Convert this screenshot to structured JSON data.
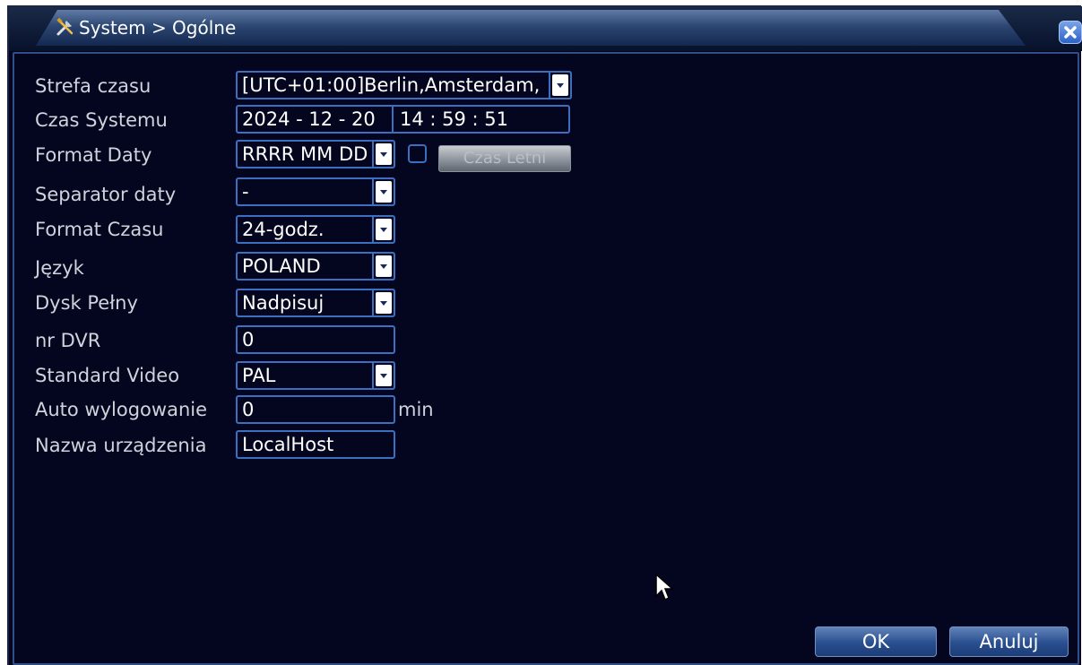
{
  "window": {
    "title": "System > Ogólne"
  },
  "form": {
    "timezone": {
      "label": "Strefa czasu",
      "value": "[UTC+01:00]Berlin,Amsterdam,"
    },
    "system_time": {
      "label": "Czas Systemu",
      "date": "2024 - 12 - 20",
      "time": "14 : 59 : 51"
    },
    "date_format": {
      "label": "Format Daty",
      "value": "RRRR MM DD",
      "dst_checked": false,
      "dst_button": "Czas Letni"
    },
    "date_separator": {
      "label": "Separator daty",
      "value": "-"
    },
    "time_format": {
      "label": "Format Czasu",
      "value": "24-godz."
    },
    "language": {
      "label": "Język",
      "value": "POLAND"
    },
    "disk_full": {
      "label": "Dysk Pełny",
      "value": "Nadpisuj"
    },
    "dvr_no": {
      "label": "nr DVR",
      "value": "0"
    },
    "video_standard": {
      "label": "Standard Video",
      "value": "PAL"
    },
    "auto_logout": {
      "label": "Auto wylogowanie",
      "value": "0",
      "unit": "min"
    },
    "device_name": {
      "label": "Nazwa urządzenia",
      "value": "LocalHost"
    }
  },
  "buttons": {
    "ok": "OK",
    "cancel": "Anuluj"
  },
  "colors": {
    "background": "#03061e",
    "field_border": "#3d6fc1",
    "label_text": "#cfd3dc"
  },
  "icons": {
    "title": "tools-icon",
    "close": "close-icon",
    "dropdown": "chevron-down-icon",
    "cursor": "mouse-pointer-icon"
  }
}
